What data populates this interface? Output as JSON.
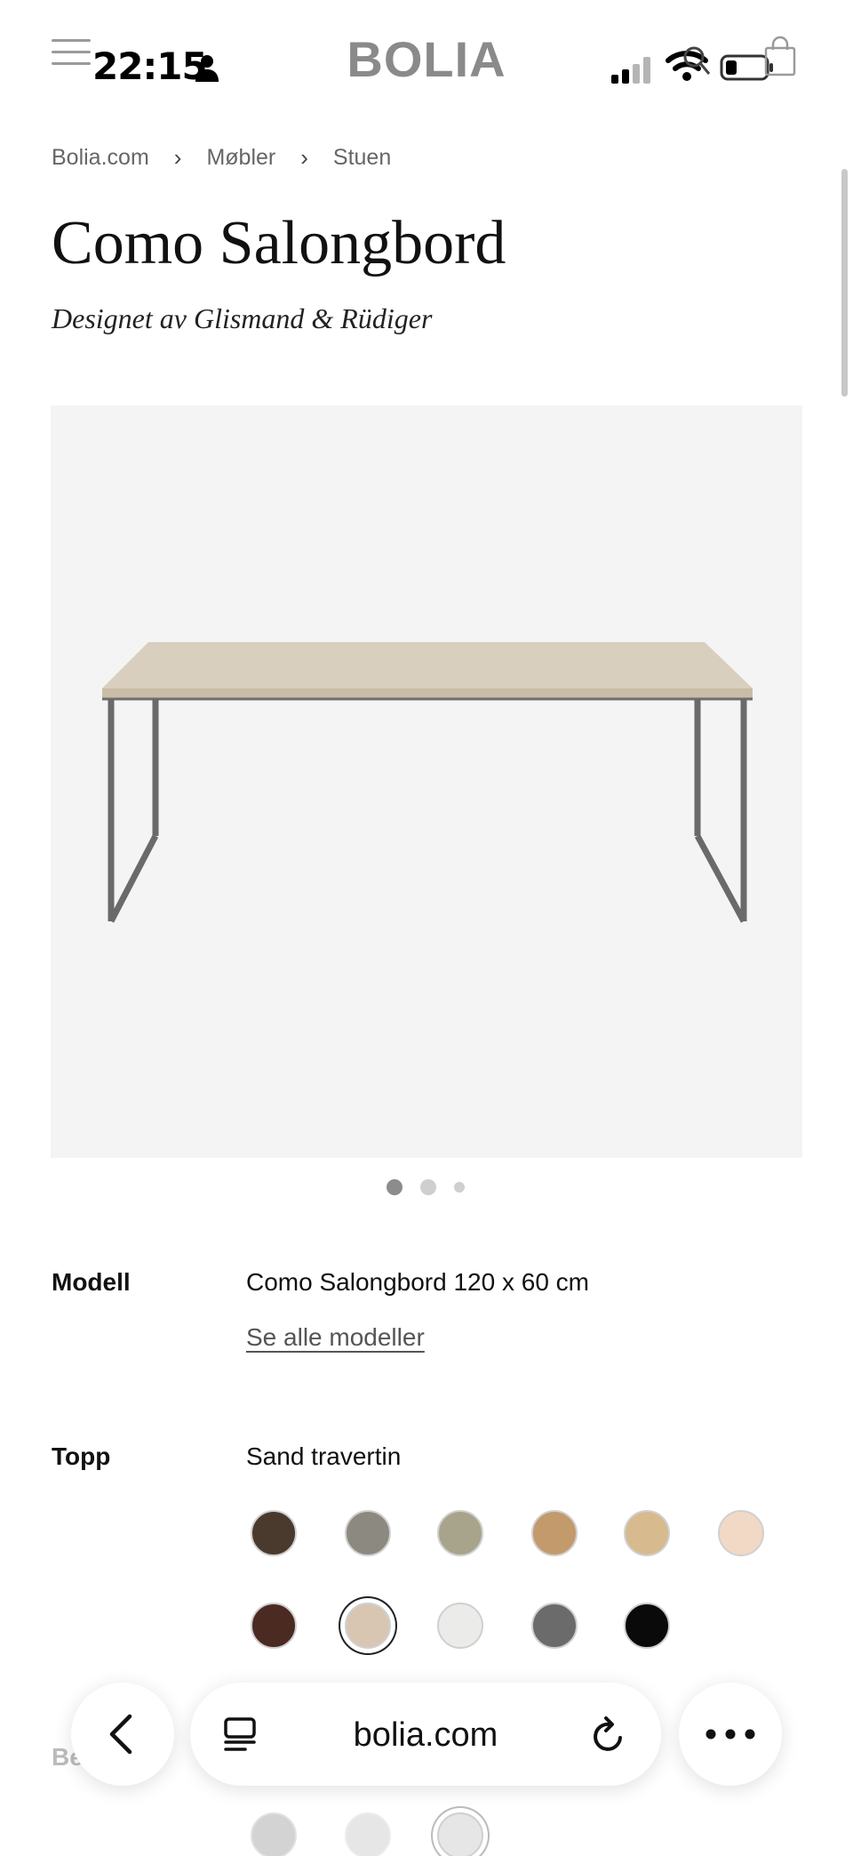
{
  "status_bar": {
    "time": "22:15",
    "brand": "BOLIA"
  },
  "breadcrumb": [
    "Bolia.com",
    "Møbler",
    "Stuen"
  ],
  "product": {
    "title": "Como Salongbord",
    "designer": "Designet av Glismand & Rüdiger",
    "carousel_count": 3,
    "carousel_active": 1
  },
  "model": {
    "label": "Modell",
    "value": "Como Salongbord 120 x 60 cm",
    "link": "Se alle modeller"
  },
  "top": {
    "label": "Topp",
    "value": "Sand travertin",
    "swatches": [
      {
        "name": "swatch-dark-wood",
        "color": "#4a3a2e"
      },
      {
        "name": "swatch-grey-stone",
        "color": "#8c8a80"
      },
      {
        "name": "swatch-sage-stone",
        "color": "#a8a48c"
      },
      {
        "name": "swatch-oak",
        "color": "#c39a6b"
      },
      {
        "name": "swatch-light-oak",
        "color": "#d7bb8e"
      },
      {
        "name": "swatch-blush",
        "color": "#f1d9c6"
      },
      {
        "name": "swatch-dark-marble",
        "color": "#4b2a22"
      },
      {
        "name": "swatch-sand-travertine",
        "color": "#d9c6b2",
        "selected": true
      },
      {
        "name": "swatch-white",
        "color": "#ebebea"
      },
      {
        "name": "swatch-dark-grey",
        "color": "#6b6b6b"
      },
      {
        "name": "swatch-black",
        "color": "#0a0a0a"
      }
    ]
  },
  "faded_next_label": "Be",
  "browser": {
    "url": "bolia.com"
  }
}
